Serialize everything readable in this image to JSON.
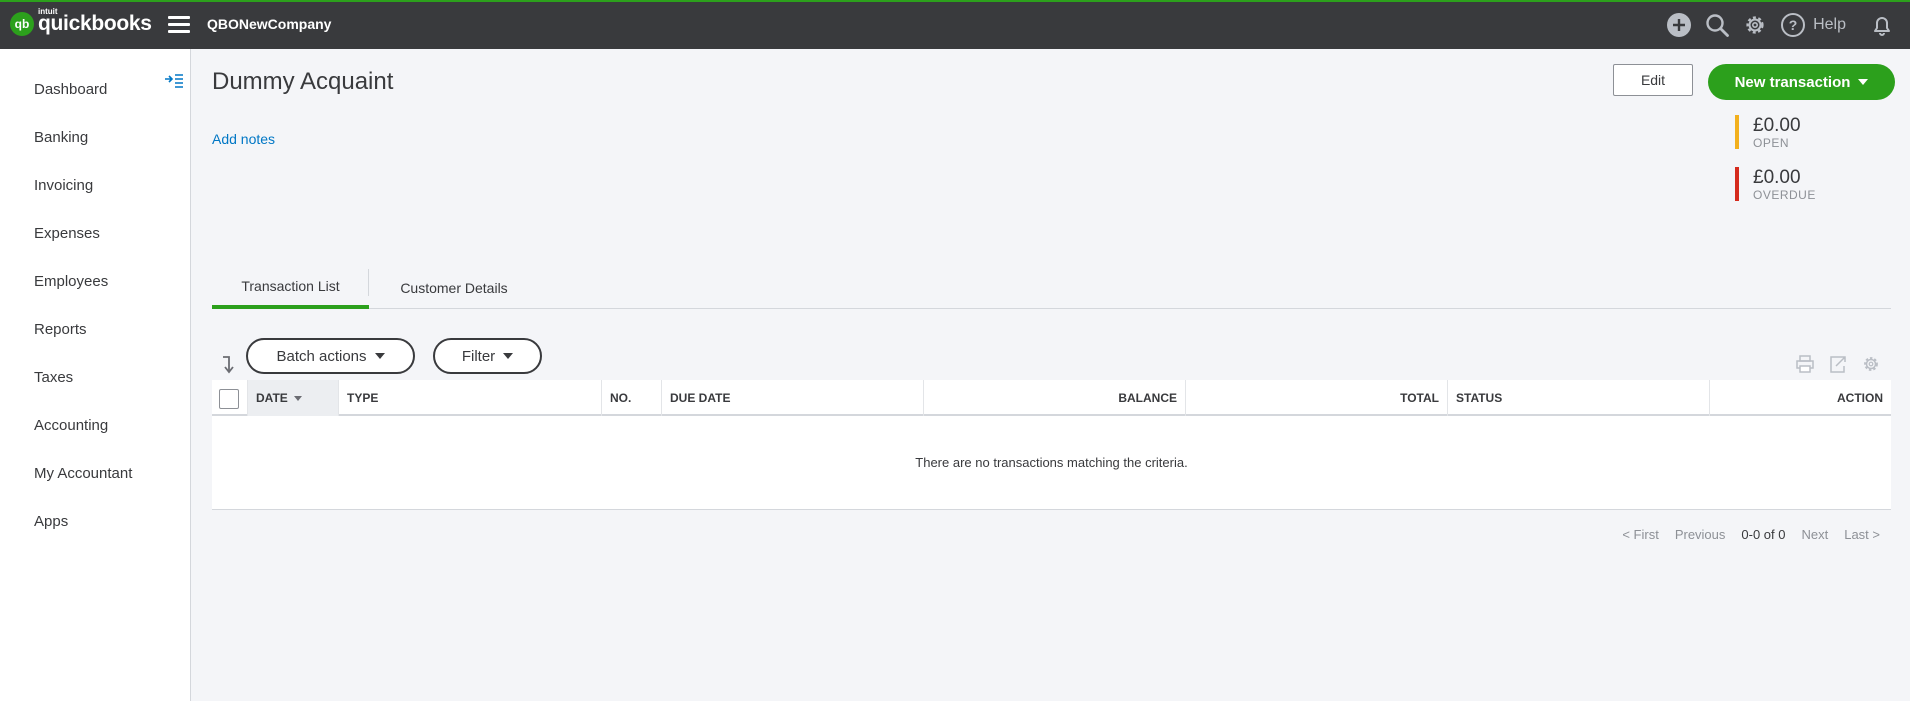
{
  "app": {
    "logo_intuit": "intuit",
    "logo_text": "quickbooks",
    "logo_mark": "qb",
    "company_name": "QBONewCompany",
    "help_label": "Help"
  },
  "sidebar": {
    "items": [
      {
        "label": "Dashboard"
      },
      {
        "label": "Banking"
      },
      {
        "label": "Invoicing"
      },
      {
        "label": "Expenses"
      },
      {
        "label": "Employees"
      },
      {
        "label": "Reports"
      },
      {
        "label": "Taxes"
      },
      {
        "label": "Accounting"
      },
      {
        "label": "My Accountant"
      },
      {
        "label": "Apps"
      }
    ]
  },
  "customer": {
    "name": "Dummy Acquaint",
    "add_notes": "Add notes",
    "edit_label": "Edit",
    "new_transaction_label": "New transaction",
    "open_amount": "£0.00",
    "open_label": "OPEN",
    "overdue_amount": "£0.00",
    "overdue_label": "OVERDUE"
  },
  "colors": {
    "open_bar": "#f2b01e",
    "overdue_bar": "#d52b1e",
    "brand_green": "#2ca01c"
  },
  "tabs": [
    {
      "label": "Transaction List",
      "active": true
    },
    {
      "label": "Customer Details",
      "active": false
    }
  ],
  "toolbar": {
    "batch_actions": "Batch actions",
    "filter": "Filter"
  },
  "table": {
    "columns": [
      "DATE",
      "TYPE",
      "NO.",
      "DUE DATE",
      "BALANCE",
      "TOTAL",
      "STATUS",
      "ACTION"
    ],
    "empty_message": "There are no transactions matching the criteria."
  },
  "pager": {
    "first": "< First",
    "previous": "Previous",
    "range": "0-0 of 0",
    "next": "Next",
    "last": "Last >"
  }
}
